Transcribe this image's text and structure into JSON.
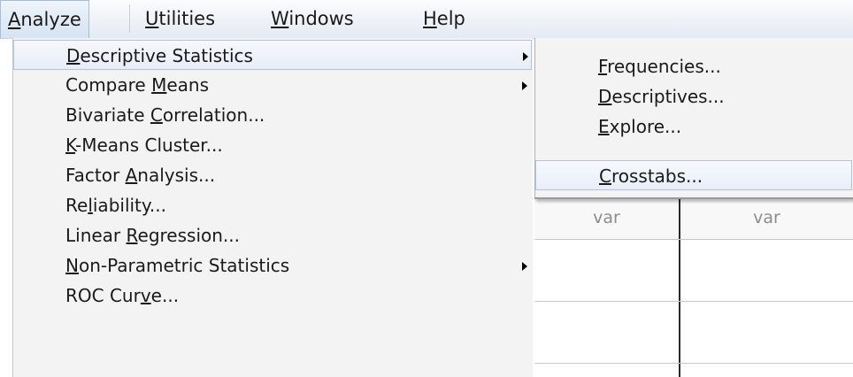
{
  "menubar": {
    "items": [
      {
        "pre": "",
        "key": "A",
        "post": "nalyze"
      },
      {
        "pre": "",
        "key": "U",
        "post": "tilities"
      },
      {
        "pre": "",
        "key": "W",
        "post": "indows"
      },
      {
        "pre": "",
        "key": "H",
        "post": "elp"
      }
    ]
  },
  "analyze_menu": {
    "items": [
      {
        "pre": "",
        "key": "D",
        "post": "escriptive Statistics"
      },
      {
        "pre": "Compare ",
        "key": "M",
        "post": "eans"
      },
      {
        "pre": "Bivariate ",
        "key": "C",
        "post": "orrelation..."
      },
      {
        "pre": "",
        "key": "K",
        "post": "-Means Cluster..."
      },
      {
        "pre": "Factor ",
        "key": "A",
        "post": "nalysis..."
      },
      {
        "pre": "Re",
        "key": "l",
        "post": "iability..."
      },
      {
        "pre": "Linear ",
        "key": "R",
        "post": "egression..."
      },
      {
        "pre": "",
        "key": "N",
        "post": "on-Parametric Statistics"
      },
      {
        "pre": "ROC Cur",
        "key": "v",
        "post": "e..."
      }
    ]
  },
  "descriptive_submenu": {
    "items": [
      {
        "pre": "",
        "key": "F",
        "post": "requencies..."
      },
      {
        "pre": "",
        "key": "D",
        "post": "escriptives..."
      },
      {
        "pre": "",
        "key": "E",
        "post": "xplore..."
      },
      {
        "pre": "",
        "key": "C",
        "post": "rosstabs..."
      }
    ]
  },
  "grid": {
    "headers": [
      "var",
      "var"
    ]
  }
}
